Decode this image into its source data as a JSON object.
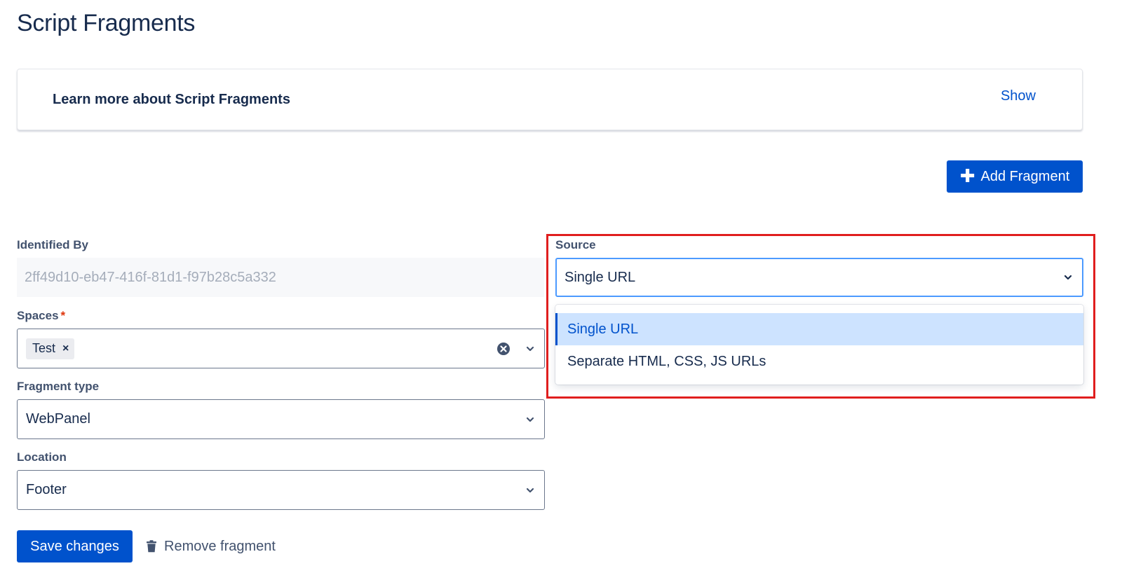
{
  "page": {
    "title": "Script Fragments"
  },
  "info_panel": {
    "title": "Learn more about Script Fragments",
    "toggle_label": "Show"
  },
  "toolbar": {
    "add_label": "Add Fragment",
    "add_icon": "plus-icon"
  },
  "form": {
    "identified_by": {
      "label": "Identified By",
      "value": "2ff49d10-eb47-416f-81d1-f97b28c5a332"
    },
    "spaces": {
      "label": "Spaces",
      "required_marker": "*",
      "tags": [
        "Test"
      ],
      "tag_remove_glyph": "×"
    },
    "fragment_type": {
      "label": "Fragment type",
      "value": "WebPanel"
    },
    "location": {
      "label": "Location",
      "value": "Footer"
    },
    "source": {
      "label": "Source",
      "value": "Single URL",
      "options": [
        "Single URL",
        "Separate HTML, CSS, JS URLs"
      ],
      "selected_index": 0
    }
  },
  "actions": {
    "save_label": "Save changes",
    "remove_label": "Remove fragment",
    "remove_icon": "trash-icon"
  },
  "colors": {
    "primary": "#0052cc",
    "text": "#172b4d",
    "highlight": "#e01e1e",
    "focus_border": "#4c9aff",
    "selected_option_bg": "#cde3ff"
  }
}
